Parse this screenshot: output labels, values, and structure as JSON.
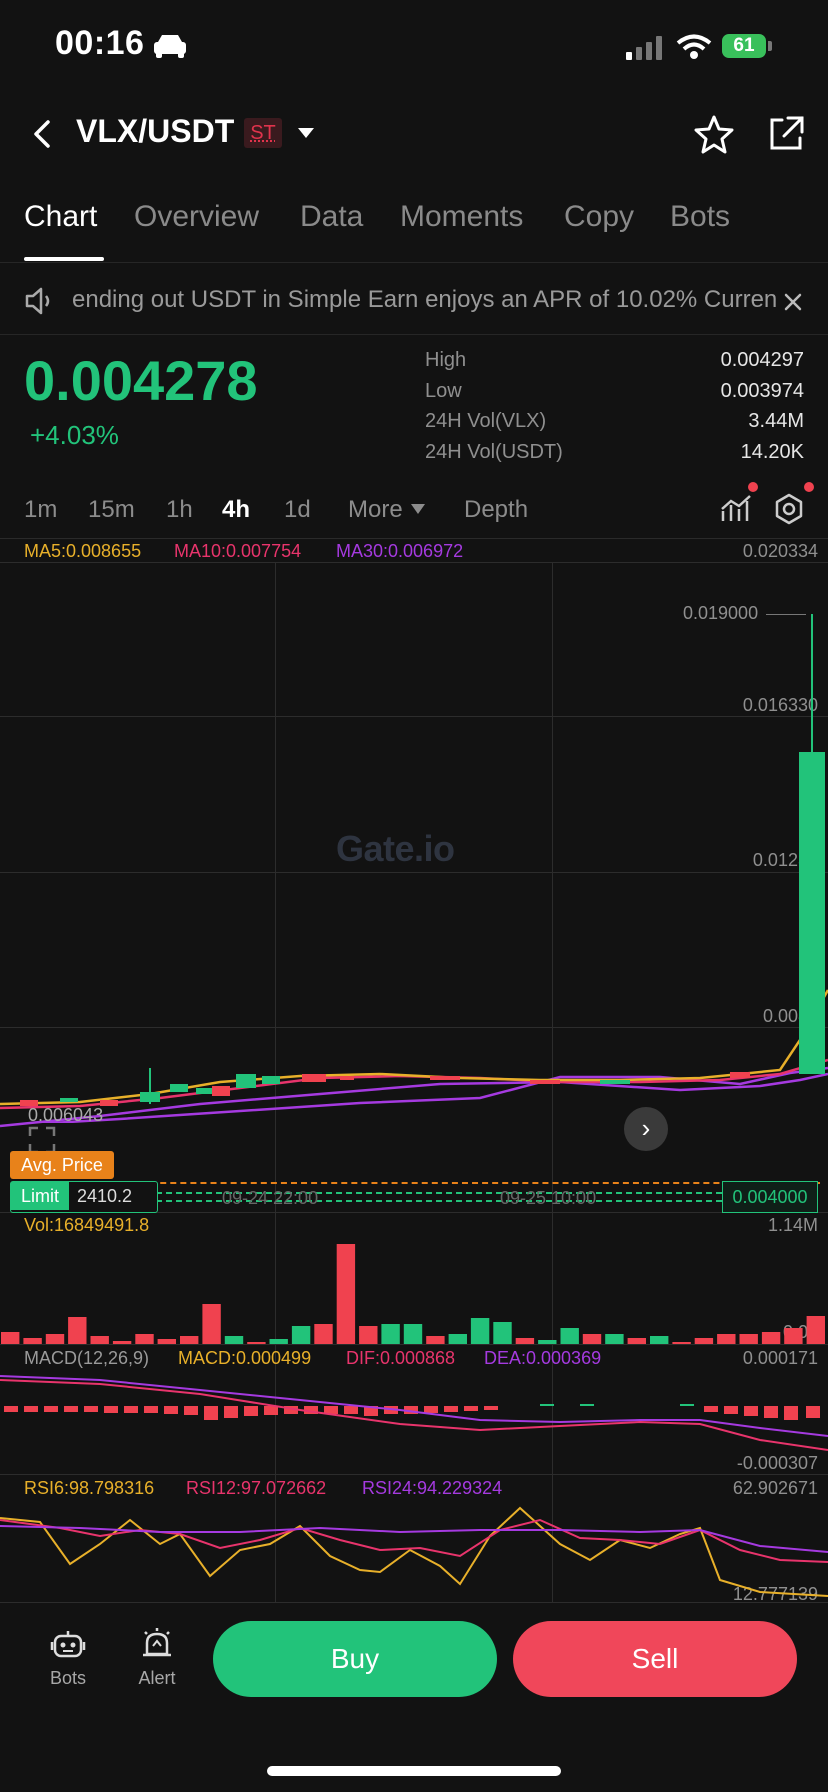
{
  "status_bar": {
    "time": "00:16",
    "battery": "61"
  },
  "header": {
    "pair": "VLX/USDT",
    "badge": "ST"
  },
  "tabs": [
    "Chart",
    "Overview",
    "Data",
    "Moments",
    "Copy",
    "Bots"
  ],
  "announcement": "ending out USDT in Simple Earn enjoys an APR of 10.02%   Curren",
  "ticker": {
    "last_price": "0.004278",
    "change": "+4.03%",
    "stats": [
      {
        "label": "High",
        "value": "0.004297"
      },
      {
        "label": "Low",
        "value": "0.003974"
      },
      {
        "label": "24H Vol(VLX)",
        "value": "3.44M"
      },
      {
        "label": "24H Vol(USDT)",
        "value": "14.20K"
      }
    ]
  },
  "intervals": [
    "1m",
    "15m",
    "1h",
    "4h",
    "1d",
    "More",
    "Depth"
  ],
  "chart": {
    "ma_legend": {
      "ma5": "MA5:0.008655",
      "ma10": "MA10:0.007754",
      "ma30": "MA30:0.006972"
    },
    "price_axis": [
      "0.020334",
      "0.016330",
      "0.01233",
      "0.0083",
      "0.019000",
      "0.006043"
    ],
    "watermark": "Gate.io",
    "avg_price_label": "Avg. Price",
    "limit": {
      "label": "Limit",
      "value": "2410.2",
      "price": "0.004000"
    },
    "time_labels": [
      "09-24 22:00",
      "09-25 10:00"
    ],
    "volume_legend": "Vol:16849491.8",
    "volume_axis": [
      "1.14M",
      "0.00"
    ],
    "macd_legend": {
      "params": "MACD(12,26,9)",
      "macd": "MACD:0.000499",
      "dif": "DIF:0.000868",
      "dea": "DEA:0.000369"
    },
    "macd_axis": [
      "0.000171",
      "-0.000307"
    ],
    "rsi_legend": {
      "rsi6": "RSI6:98.798316",
      "rsi12": "RSI12:97.072662",
      "rsi24": "RSI24:94.229324"
    },
    "rsi_axis": [
      "62.902671",
      "12.777139"
    ]
  },
  "bottom_bar": {
    "bots": "Bots",
    "alert": "Alert",
    "buy": "Buy",
    "sell": "Sell"
  },
  "colors": {
    "up": "#22c37a",
    "down": "#f0424f",
    "ma5": "#e8b02a",
    "ma10": "#e8346c",
    "ma30": "#a53ae0"
  },
  "chart_data": {
    "type": "candlestick",
    "title": "",
    "price_range": [
      0.003,
      0.020334
    ],
    "candles_note_values": [
      0.005,
      0.0052,
      0.0053,
      0.0054,
      0.0054,
      0.0053,
      0.0052,
      0.0052,
      0.0051,
      0.005,
      0.005,
      0.0051,
      0.0052,
      0.0053,
      0.0163,
      0.019
    ],
    "volume": [
      0.12,
      0.06,
      0.1,
      0.27,
      0.08,
      0.03,
      0.1,
      0.05,
      0.08,
      0.4,
      0.08,
      0.02,
      0.05,
      0.18,
      0.2,
      1.0,
      0.18,
      0.2,
      0.2,
      0.08,
      0.1,
      0.26,
      0.22,
      0.06,
      0.04,
      0.16,
      0.1,
      0.1,
      0.06,
      0.08,
      0.02,
      0.06,
      0.1,
      0.1,
      0.12,
      0.16,
      0.28
    ]
  }
}
